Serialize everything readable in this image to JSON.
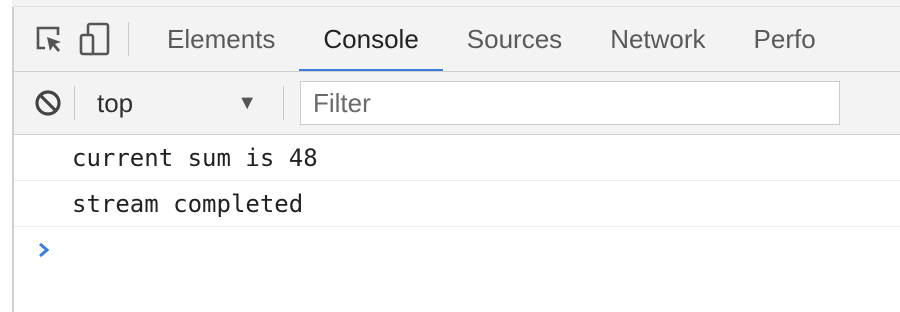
{
  "tabs": [
    {
      "label": "Elements",
      "active": false
    },
    {
      "label": "Console",
      "active": true
    },
    {
      "label": "Sources",
      "active": false
    },
    {
      "label": "Network",
      "active": false
    },
    {
      "label": "Perfo",
      "active": false
    }
  ],
  "icons": {
    "inspect": "inspect-element-icon",
    "device": "device-toolbar-icon",
    "clear": "clear-console-icon",
    "dropdown": "dropdown-caret-icon",
    "prompt": "prompt-chevron-icon"
  },
  "toolbar": {
    "context_value": "top",
    "caret": "▼",
    "filter_placeholder": "Filter",
    "filter_value": ""
  },
  "console": {
    "messages": [
      "current sum is 48",
      "stream completed"
    ]
  },
  "colors": {
    "accent": "#3a7cdf",
    "prompt": "#3a7cdf",
    "toolbar_bg": "#f3f3f3"
  }
}
